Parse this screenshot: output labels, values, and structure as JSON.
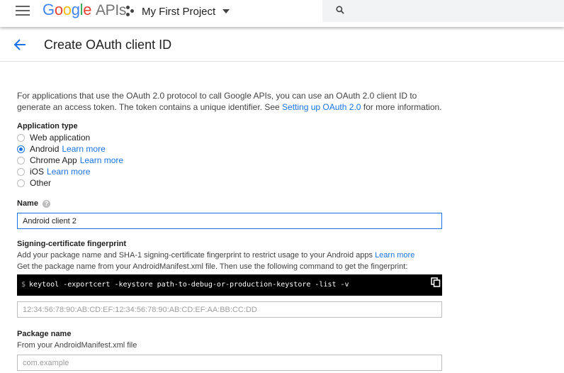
{
  "header": {
    "logo_google": "Google",
    "logo_apis": "APIs",
    "project_name": "My First Project"
  },
  "page": {
    "title": "Create OAuth client ID"
  },
  "intro": {
    "text_before": "For applications that use the OAuth 2.0 protocol to call Google APIs, you can use an OAuth 2.0 client ID to generate an access token. The token contains a unique identifier. See ",
    "link": "Setting up OAuth 2.0",
    "text_after": " for more information."
  },
  "application_type": {
    "label": "Application type",
    "options": [
      {
        "label": "Web application",
        "link": ""
      },
      {
        "label": "Android",
        "link": "Learn more"
      },
      {
        "label": "Chrome App",
        "link": "Learn more"
      },
      {
        "label": "iOS",
        "link": "Learn more"
      },
      {
        "label": "Other",
        "link": ""
      }
    ],
    "selected": "Android"
  },
  "name_field": {
    "label": "Name",
    "value": "Android client 2"
  },
  "fingerprint": {
    "label": "Signing-certificate fingerprint",
    "desc_line1": "Add your package name and SHA-1 signing-certificate fingerprint to restrict usage to your Android apps ",
    "desc_link": "Learn more",
    "desc_line2": "Get the package name from your AndroidManifest.xml file. Then use the following command to get the fingerprint:",
    "command_prompt": "$",
    "command": "keytool -exportcert -keystore path-to-debug-or-production-keystore -list -v",
    "placeholder": "12:34:56:78:90:AB:CD:EF:12:34:56:78:90:AB:CD:EF:AA:BB:CC:DD"
  },
  "package_name": {
    "label": "Package name",
    "desc": "From your AndroidManifest.xml file",
    "placeholder": "com.example"
  },
  "colors": {
    "accent": "#1a73e8",
    "google_blue": "#4285F4",
    "google_red": "#EA4335",
    "google_yellow": "#FBBC05",
    "google_green": "#34A853"
  }
}
